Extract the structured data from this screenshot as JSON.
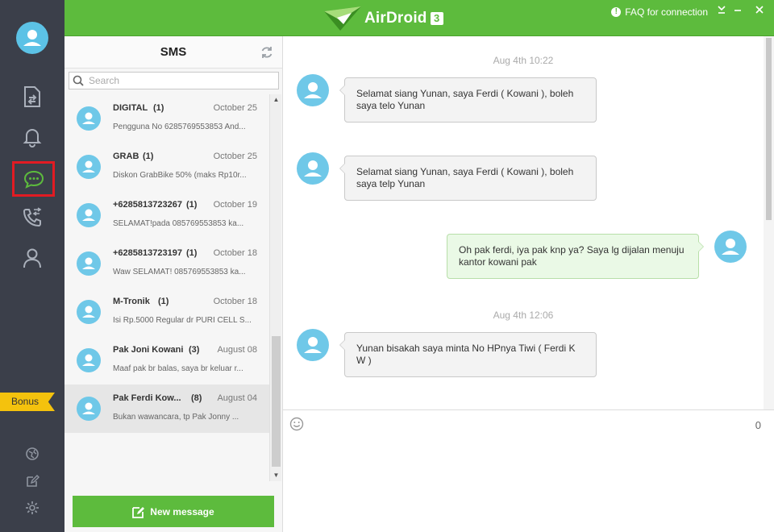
{
  "app": {
    "name": "AirDroid",
    "version": "3",
    "faq_label": "FAQ for connection",
    "brand_color": "#5dbb3d"
  },
  "rail": {
    "nav": [
      {
        "icon": "file-transfer-icon"
      },
      {
        "icon": "bell-icon"
      },
      {
        "icon": "sms-icon",
        "active": true
      },
      {
        "icon": "call-log-icon"
      },
      {
        "icon": "contacts-icon"
      }
    ],
    "bonus_label": "Bonus",
    "bottom": [
      {
        "icon": "globe-icon"
      },
      {
        "icon": "edit-icon"
      },
      {
        "icon": "settings-icon"
      }
    ]
  },
  "list": {
    "title": "SMS",
    "search_placeholder": "Search",
    "new_message_label": "New message",
    "items": [
      {
        "name": "DIGITAL",
        "count": "(1)",
        "date": "October 25",
        "preview": "Pengguna No 6285769553853 And..."
      },
      {
        "name": "GRAB",
        "count": "(1)",
        "date": "October 25",
        "preview": "Diskon GrabBike 50% (maks Rp10r..."
      },
      {
        "name": "+6285813723267",
        "count": "(1)",
        "date": "October 19",
        "preview": "SELAMAT!pada 085769553853 ka..."
      },
      {
        "name": "+6285813723197",
        "count": "(1)",
        "date": "October 18",
        "preview": "Waw SELAMAT! 085769553853 ka..."
      },
      {
        "name": "M-Tronik",
        "count": "(1)",
        "date": "October 18",
        "preview": "Isi Rp.5000 Regular dr PURI CELL S..."
      },
      {
        "name": "Pak Joni Kowani",
        "count": "(3)",
        "date": "August 08",
        "preview": "Maaf pak br balas, saya br keluar r..."
      },
      {
        "name": "Pak Ferdi Kow...",
        "count": "(8)",
        "date": "August 04",
        "preview": "Bukan wawancara, tp Pak Jonny ...",
        "selected": true
      }
    ]
  },
  "conversation": {
    "timestamps": [
      "Aug 4th 10:22",
      "Aug 4th 12:06"
    ],
    "messages": [
      {
        "dir": "in",
        "text": "Selamat siang Yunan, saya Ferdi ( Kowani ), boleh saya telo Yunan"
      },
      {
        "dir": "in",
        "text": "Selamat siang Yunan, saya Ferdi ( Kowani ), boleh saya telp Yunan"
      },
      {
        "dir": "out",
        "text": "Oh pak ferdi, iya pak knp ya? Saya lg dijalan menuju kantor kowani pak"
      },
      {
        "dir": "in",
        "text": "Yunan bisakah saya minta No HPnya Tiwi ( Ferdi K W )"
      }
    ],
    "char_count": "0"
  }
}
